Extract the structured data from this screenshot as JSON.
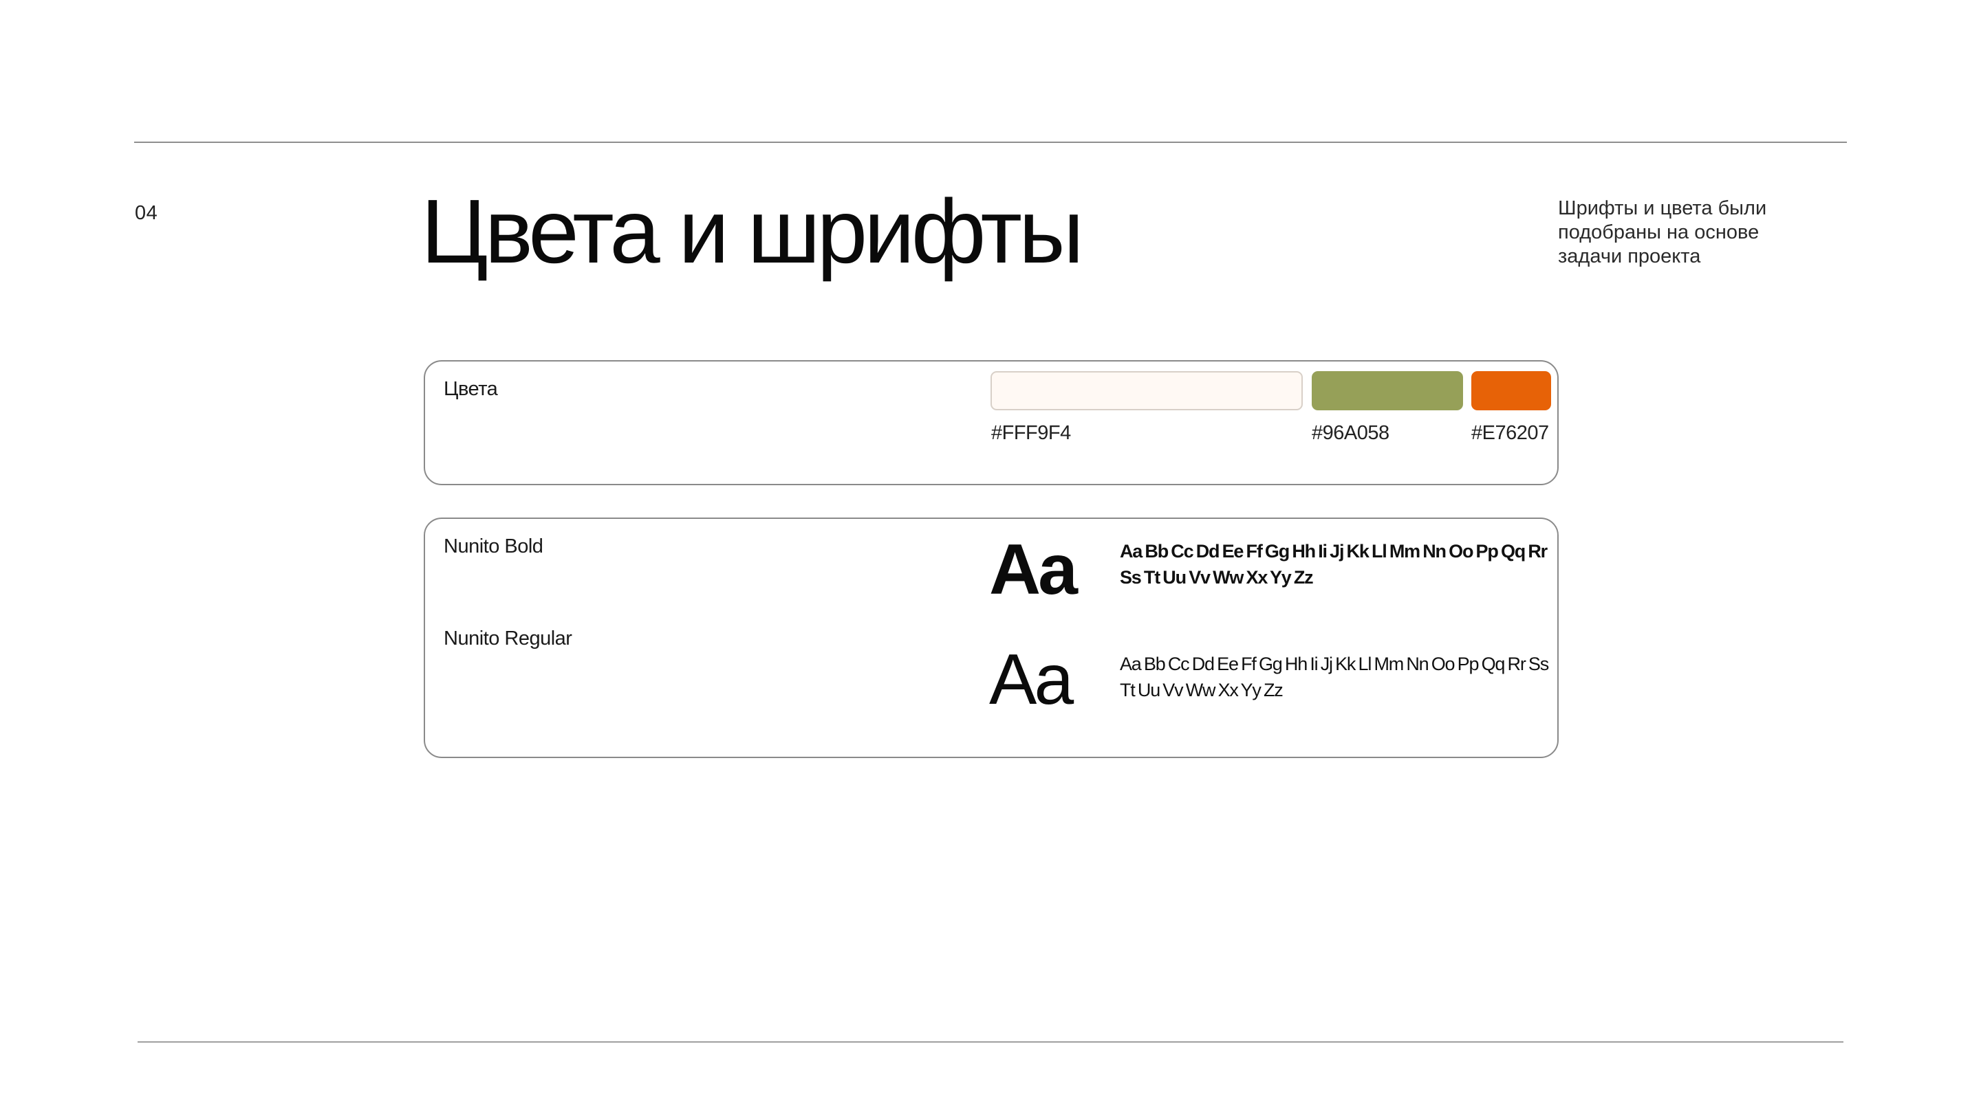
{
  "slide": {
    "page_number": "04",
    "title": "Цвета и шрифты",
    "note": "Шрифты и цвета были подобраны на основе задачи проекта"
  },
  "colors_card": {
    "label": "Цвета",
    "swatches": [
      {
        "hex": "#FFF9F4",
        "label": "#FFF9F4"
      },
      {
        "hex": "#96A058",
        "label": "#96A058"
      },
      {
        "hex": "#E76207",
        "label": "#E76207"
      }
    ]
  },
  "fonts_card": {
    "fonts": [
      {
        "name": "Nunito Bold",
        "glyph": "Aa",
        "alphabet": "Aa Bb Cc Dd Ee Ff Gg Hh Ii Jj Kk Ll Mm Nn Oo Pp Qq Rr Ss Tt Uu Vv Ww Xx Yy Zz"
      },
      {
        "name": "Nunito Regular",
        "glyph": "Aa",
        "alphabet": "Aa Bb Cc Dd Ee Ff Gg Hh Ii Jj Kk Ll Mm Nn Oo Pp Qq Rr Ss Tt Uu Vv Ww Xx Yy Zz"
      }
    ]
  }
}
